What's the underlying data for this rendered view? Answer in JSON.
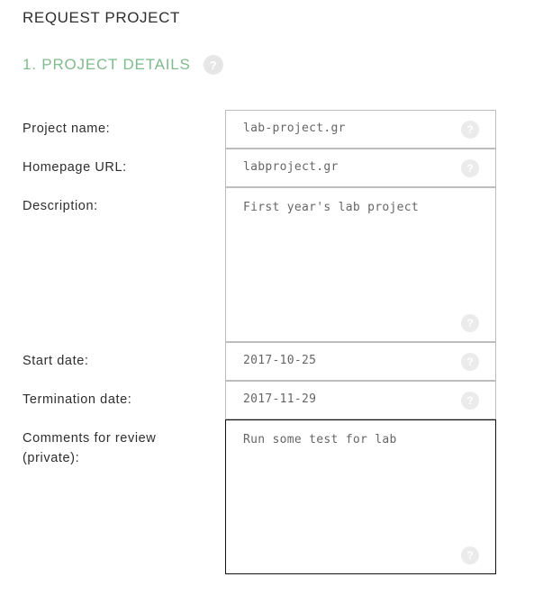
{
  "page": {
    "title": "REQUEST PROJECT"
  },
  "section": {
    "title": "1. PROJECT DETAILS",
    "help_glyph": "?"
  },
  "fields": {
    "project_name": {
      "label": "Project name:",
      "value": "lab-project.gr",
      "help_glyph": "?"
    },
    "homepage_url": {
      "label": "Homepage URL:",
      "value": "labproject.gr",
      "help_glyph": "?"
    },
    "description": {
      "label": "Description:",
      "value": "First year's lab project",
      "help_glyph": "?"
    },
    "start_date": {
      "label": "Start date:",
      "value": "2017-10-25",
      "help_glyph": "?"
    },
    "termination_date": {
      "label": "Termination date:",
      "value": "2017-11-29",
      "help_glyph": "?"
    },
    "comments": {
      "label_line1": "Comments for review",
      "label_line2": "(private):",
      "value": "Run some test for lab",
      "help_glyph": "?"
    }
  },
  "colors": {
    "section_accent": "#7fbb8e",
    "field_border": "#bdbdbd",
    "focused_border": "#111111",
    "help_icon_bg": "#ebebeb"
  },
  "icons": {
    "help": "question-mark-circle-icon"
  }
}
